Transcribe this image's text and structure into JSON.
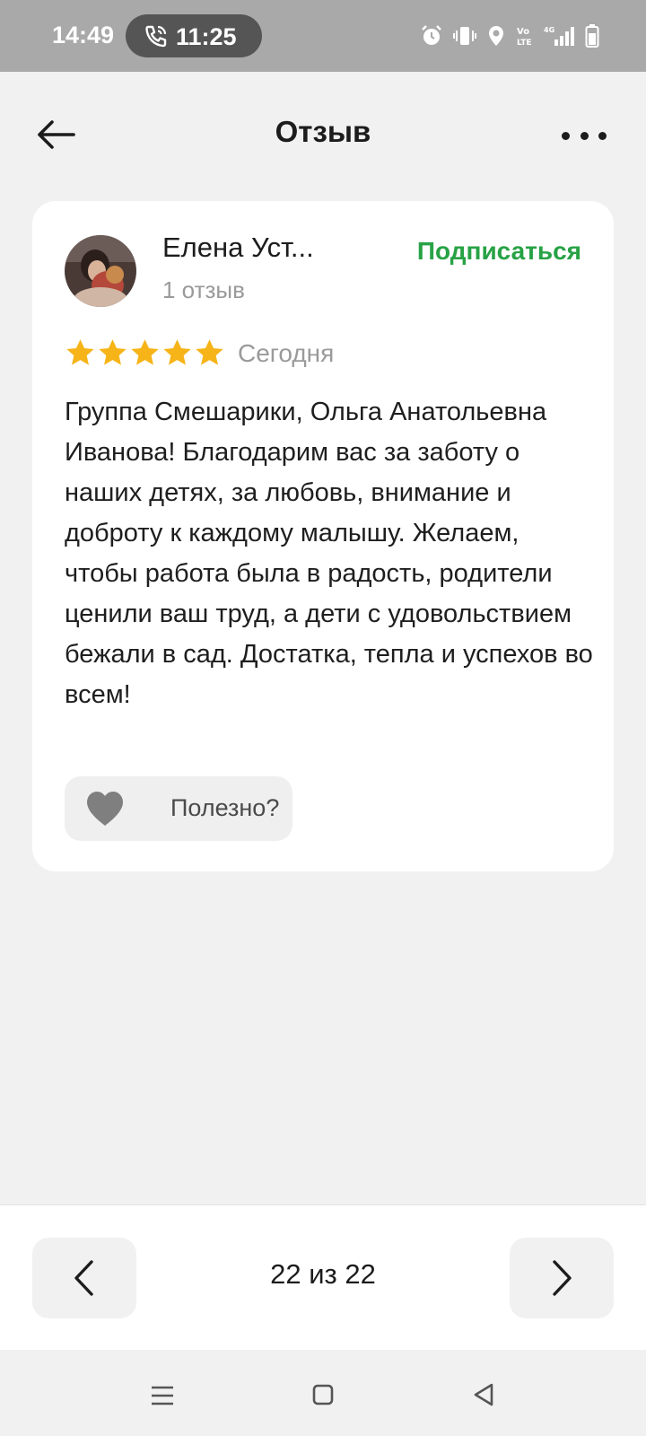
{
  "status_bar": {
    "time": "14:49",
    "call_timer": "11:25",
    "icons": [
      "alarm-icon",
      "vibrate-icon",
      "location-icon",
      "volte-icon",
      "4g-signal-icon",
      "battery-icon"
    ]
  },
  "header": {
    "title": "Отзыв",
    "back_icon": "arrow-left-icon",
    "more_icon": "more-dots-icon"
  },
  "review": {
    "author": "Елена Уст...",
    "reviews_count": "1 отзыв",
    "subscribe_label": "Подписаться",
    "rating": 5,
    "rating_max": 5,
    "date": "Сегодня",
    "text": "Группа Смешарики, Ольга Анатольевна Иванова! Благодарим вас за заботу о наших детях, за любовь, внимание и доброту к каждому малышу. Желаем, чтобы работа была в радость, родители ценили ваш труд, а дети с удовольствием бежали в сад. Достатка, тепла и успехов во всем!",
    "helpful_label": "Полезно?"
  },
  "pager": {
    "counter": "22 из 22"
  },
  "colors": {
    "accent_green": "#27a245",
    "star_yellow": "#f6b418",
    "status_bar_bg": "#a9a9a9",
    "page_bg": "#f1f1f1"
  }
}
